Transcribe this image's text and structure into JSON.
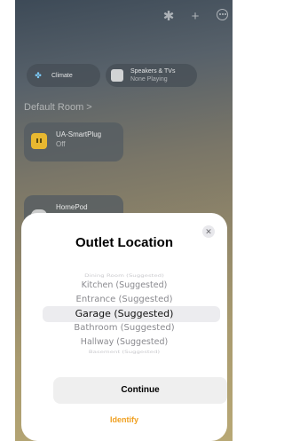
{
  "topbar": {
    "icons": [
      "waveform-icon",
      "plus-icon",
      "more-icon"
    ]
  },
  "chips": {
    "climate": {
      "label": "Climate"
    },
    "speakers": {
      "label": "Speakers & TVs",
      "status": "None Playing"
    }
  },
  "room": {
    "title": "Default Room >",
    "tiles": [
      {
        "name": "UA-SmartPlug",
        "status": "Off"
      },
      {
        "name": "HomePod",
        "status": ""
      }
    ]
  },
  "sheet": {
    "title": "Outlet Location",
    "close_label": "✕",
    "picker": {
      "selected_index": 3,
      "options": [
        "Dining Room (Suggested)",
        "Kitchen (Suggested)",
        "Entrance (Suggested)",
        "Garage (Suggested)",
        "Bathroom (Suggested)",
        "Hallway (Suggested)",
        "Basement (Suggested)"
      ]
    },
    "continue_label": "Continue",
    "identify_label": "Identify"
  },
  "colors": {
    "accent": "#f0a020",
    "sheet_bg": "#ffffff",
    "button_bg": "#efefef"
  }
}
